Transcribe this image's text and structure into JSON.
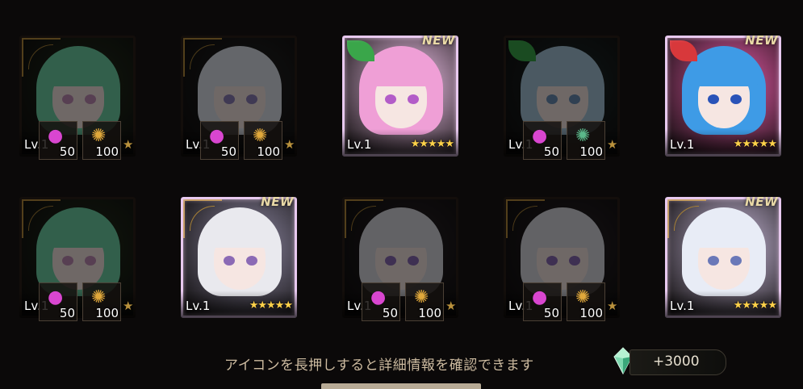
{
  "cards": [
    {
      "id": "c1",
      "new": false,
      "dim": true,
      "level": "Lv.1",
      "hair": "#6fd3a7",
      "eyes": "#c08db6",
      "bg": "#26321f",
      "frame_accent": "#b68c3c",
      "materials": [
        {
          "icon": "apple-icon",
          "value": "50"
        },
        {
          "icon": "gold-ore-icon",
          "value": "100"
        }
      ],
      "star": "★"
    },
    {
      "id": "c2",
      "new": false,
      "dim": true,
      "level": "Lv.1",
      "hair": "#dde3ec",
      "eyes": "#8d7eb8",
      "bg": "#262626",
      "frame_accent": "#b68c3c",
      "materials": [
        {
          "icon": "apple-icon",
          "value": "50"
        },
        {
          "icon": "gold-ore-icon",
          "value": "100"
        }
      ],
      "star": "★"
    },
    {
      "id": "c3",
      "new": true,
      "dim": false,
      "new_label": "NEW",
      "level": "Lv.1",
      "hair": "#ef9fd6",
      "eyes": "#b35cc8",
      "bg": "#f0c3ea",
      "frame_accent": "#3aa64a",
      "stars": "★★★★★"
    },
    {
      "id": "c4",
      "new": false,
      "dim": true,
      "level": "Lv.1",
      "hair": "#a7c6d9",
      "eyes": "#6b8fb5",
      "bg": "#1f2a2a",
      "frame_accent": "#3aa64a",
      "materials": [
        {
          "icon": "apple-icon",
          "value": "50"
        },
        {
          "icon": "green-ore-icon",
          "value": "100"
        }
      ],
      "star": "★"
    },
    {
      "id": "c5",
      "new": true,
      "dim": false,
      "new_label": "NEW",
      "level": "Lv.1",
      "hair": "#3e9be6",
      "eyes": "#2a53b8",
      "bg": "#e45aa6",
      "frame_accent": "#d8383b",
      "stars": "★★★★★"
    },
    {
      "id": "c6",
      "new": false,
      "dim": true,
      "level": "Lv.1",
      "hair": "#6fd3a7",
      "eyes": "#c08db6",
      "bg": "#26321f",
      "frame_accent": "#b68c3c",
      "materials": [
        {
          "icon": "apple-icon",
          "value": "50"
        },
        {
          "icon": "gold-ore-icon",
          "value": "100"
        }
      ],
      "star": "★"
    },
    {
      "id": "c7",
      "new": true,
      "dim": false,
      "new_label": "NEW",
      "level": "Lv.1",
      "hair": "#e9e9ee",
      "eyes": "#8b6ab5",
      "bg": "#8c86a0",
      "frame_accent": "#b68c3c",
      "stars": "★★★★★"
    },
    {
      "id": "c8",
      "new": false,
      "dim": true,
      "level": "Lv.1",
      "hair": "#d9d9df",
      "eyes": "#8b6ab5",
      "bg": "#2a2428",
      "frame_accent": "#b68c3c",
      "materials": [
        {
          "icon": "apple-icon",
          "value": "50"
        },
        {
          "icon": "gold-ore-icon",
          "value": "100"
        }
      ],
      "star": "★"
    },
    {
      "id": "c9",
      "new": false,
      "dim": true,
      "level": "Lv.1",
      "hair": "#d9d9df",
      "eyes": "#8b6ab5",
      "bg": "#2a2428",
      "frame_accent": "#b68c3c",
      "materials": [
        {
          "icon": "apple-icon",
          "value": "50"
        },
        {
          "icon": "gold-ore-icon",
          "value": "100"
        }
      ],
      "star": "★"
    },
    {
      "id": "c10",
      "new": true,
      "dim": false,
      "new_label": "NEW",
      "level": "Lv.1",
      "hair": "#e8ecf6",
      "eyes": "#6a78b8",
      "bg": "#c7b8d8",
      "frame_accent": "#b68c3c",
      "stars": "★★★★★"
    }
  ],
  "hint_text": "アイコンを長押しすると詳細情報を確認できます",
  "reward": {
    "icon": "crystal-icon",
    "value": "+3000"
  }
}
